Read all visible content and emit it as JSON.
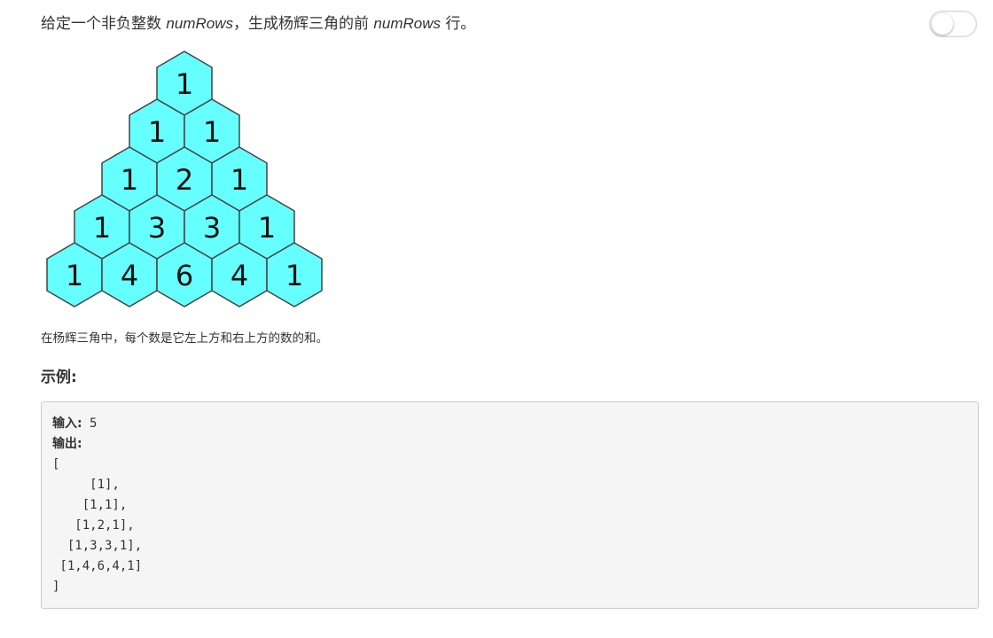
{
  "intro": {
    "prefix": "给定一个非负整数 ",
    "var1": "numRows",
    "middle": "，生成杨辉三角的前 ",
    "var2": "numRows",
    "suffix": " 行。"
  },
  "toggle": {
    "state": "off"
  },
  "triangle": {
    "rows": [
      [
        1
      ],
      [
        1,
        1
      ],
      [
        1,
        2,
        1
      ],
      [
        1,
        3,
        3,
        1
      ],
      [
        1,
        4,
        6,
        4,
        1
      ]
    ],
    "fill": "#66ffff",
    "stroke": "#444444"
  },
  "caption": "在杨辉三角中，每个数是它左上方和右上方的数的和。",
  "example": {
    "title": "示例:",
    "input_label": "输入:",
    "input_value": " 5",
    "output_label": "输出:",
    "output_lines": [
      "[",
      "     [1],",
      "    [1,1],",
      "   [1,2,1],",
      "  [1,3,3,1],",
      " [1,4,6,4,1]",
      "]"
    ]
  }
}
